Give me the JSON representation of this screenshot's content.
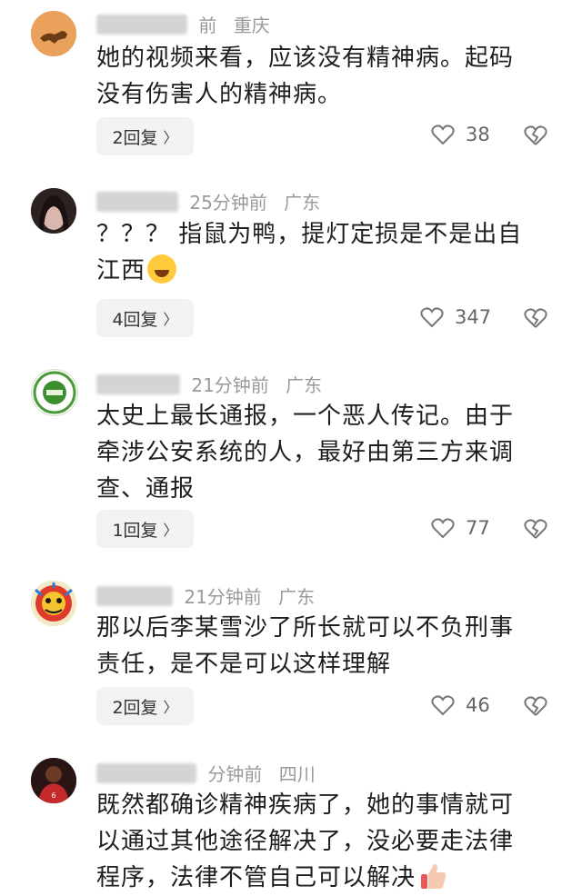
{
  "colors": {
    "meta_text": "#9a9a9a",
    "reply_bg": "#f2f2f2",
    "icon": "#777777"
  },
  "comments": [
    {
      "time": "前",
      "location": "重庆",
      "text_lines": [
        "她的视频来看，应该没有精神病。起码",
        "没有伤害人的精神病。"
      ],
      "reply_label": "2回复",
      "likes": "38",
      "avatar_icon": "sand-animal-avatar"
    },
    {
      "time": "25分钟前",
      "location": "广东",
      "text_lines": [
        "？？？ 指鼠为鸭，提灯定损是不是出自",
        "江西"
      ],
      "reply_label": "4回复",
      "likes": "347",
      "avatar_icon": "woman-avatar"
    },
    {
      "time": "21分钟前",
      "location": "广东",
      "text_lines": [
        "太史上最长通报，一个恶人传记。由于",
        "牵涉公安系统的人，最好由第三方来调",
        "查、通报"
      ],
      "reply_label": "1回复",
      "likes": "77",
      "avatar_icon": "green-badge-avatar"
    },
    {
      "time": "21分钟前",
      "location": "广东",
      "text_lines": [
        "那以后李某雪沙了所长就可以不负刑事",
        "责任，是不是可以这样理解"
      ],
      "reply_label": "2回复",
      "likes": "46",
      "avatar_icon": "lion-mask-avatar"
    },
    {
      "time": "分钟前",
      "location": "四川",
      "text_lines": [
        "既然都确诊精神疾病了，她的事情就可",
        "以通过其他途径解决了，没必要走法律",
        "程序，法律不管自己可以解决"
      ],
      "avatar_icon": "athlete-avatar"
    }
  ]
}
